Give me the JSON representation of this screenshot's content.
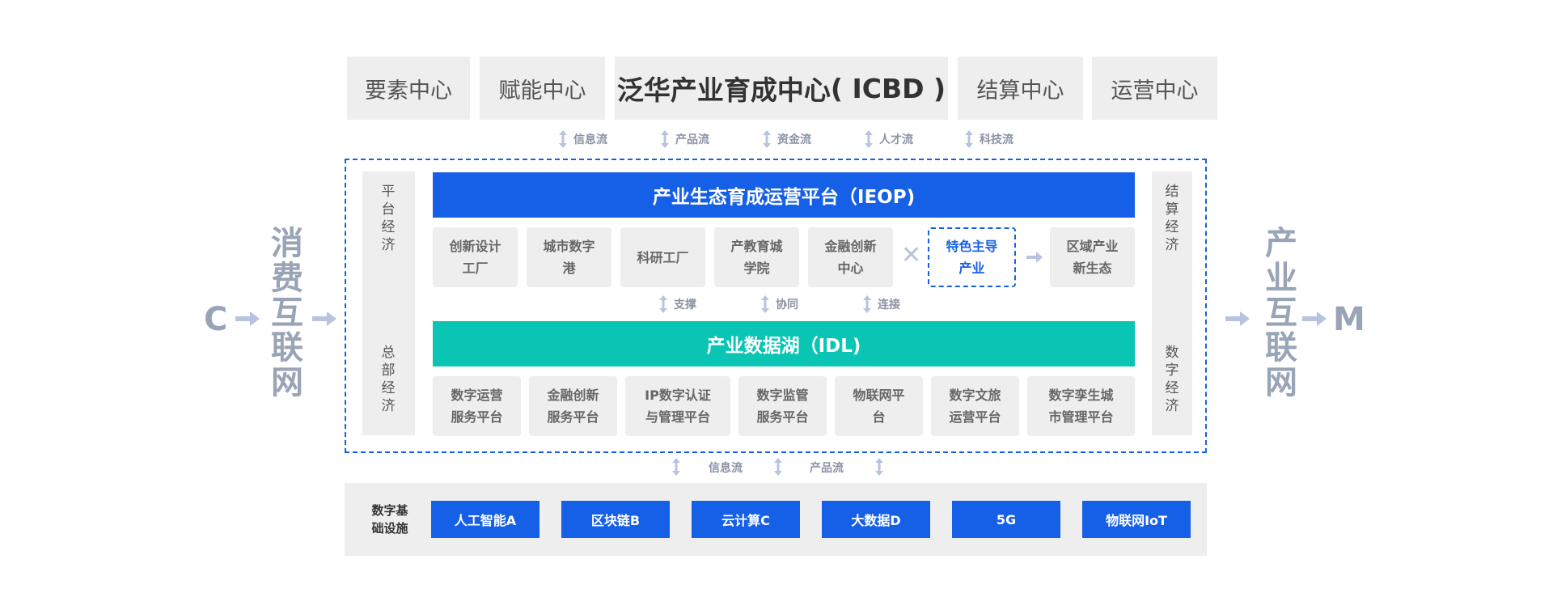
{
  "top_row": {
    "left1": "要素中心",
    "left2": "赋能中心",
    "center_title": "泛华产业育成中心",
    "center_sub": "( ICBD )",
    "right1": "结算中心",
    "right2": "运营中心"
  },
  "top_flows": [
    "信息流",
    "产品流",
    "资金流",
    "人才流",
    "科技流"
  ],
  "left_side": {
    "C": "C",
    "vertical": "消费互联网"
  },
  "right_side": {
    "vertical": "产业互联网",
    "M": "M"
  },
  "left_panel": {
    "top": "平台经济",
    "bottom": "总部经济"
  },
  "right_panel": {
    "top": "结算经济",
    "bottom": "数字经济"
  },
  "ieop": {
    "title": "产业生态育成运营平台（IEOP)",
    "color": "#1660e8"
  },
  "ieop_cards": [
    "创新设计\n工厂",
    "城市数字\n港",
    "科研工厂",
    "产教育城\n学院",
    "金融创新\n中心"
  ],
  "featured_card": "特色主导\n产业",
  "region_card": "区域产业\n新生态",
  "mid_flows": [
    "支撑",
    "协同",
    "连接"
  ],
  "idl": {
    "title": "产业数据湖（IDL)",
    "color": "#0ac5b4"
  },
  "idl_cards": [
    "数字运营\n服务平台",
    "金融创新\n服务平台",
    "IP数字认证\n与管理平台",
    "数字监管\n服务平台",
    "物联网平\n台",
    "数字文旅\n运营平台",
    "数字孪生城\n市管理平台"
  ],
  "bottom_flows": [
    "信息流",
    "产品流"
  ],
  "infra": {
    "label": "数字基\n础设施",
    "items": [
      "人工智能A",
      "区块链B",
      "云计算C",
      "大数据D",
      "5G",
      "物联网IoT"
    ]
  },
  "colors": {
    "accent_blue": "#1660e8",
    "accent_teal": "#0ac5b4",
    "muted": "#9aa4b7"
  },
  "icons": [
    "double-arrow-icon",
    "right-arrow-icon",
    "x-icon"
  ]
}
